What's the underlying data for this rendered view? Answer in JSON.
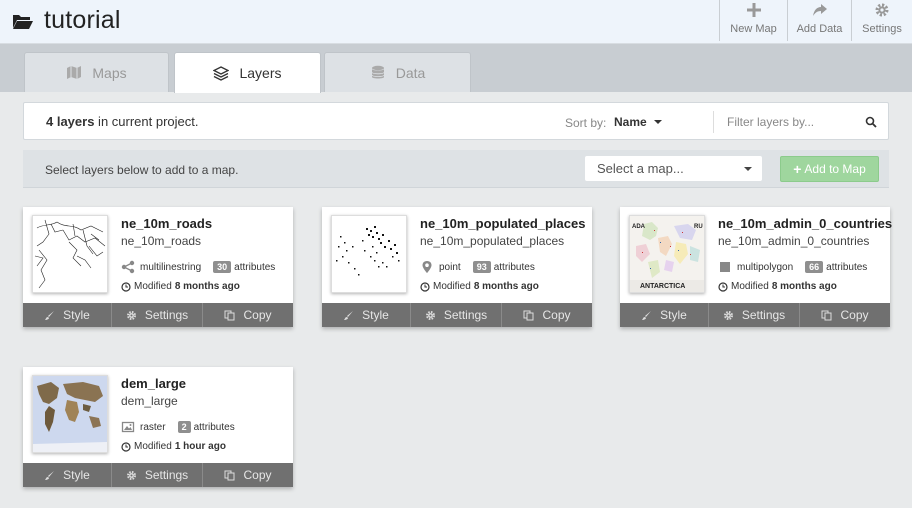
{
  "project": {
    "name": "tutorial"
  },
  "top_actions": [
    {
      "label": "New Map",
      "icon": "plus-icon"
    },
    {
      "label": "Add Data",
      "icon": "share-icon"
    },
    {
      "label": "Settings",
      "icon": "gear-icon"
    }
  ],
  "tabs": [
    {
      "label": "Maps",
      "icon": "map-icon",
      "active": false
    },
    {
      "label": "Layers",
      "icon": "layers-icon",
      "active": true
    },
    {
      "label": "Data",
      "icon": "database-icon",
      "active": false
    }
  ],
  "summary": {
    "count_text": "4 layers",
    "rest_text": " in current project.",
    "sort_label": "Sort by:",
    "sort_value": "Name",
    "filter_placeholder": "Filter layers by..."
  },
  "select_row": {
    "instruction": "Select layers below to add to a map.",
    "map_select_placeholder": "Select a map...",
    "add_button": "Add to Map",
    "add_button_color": "#9fd69e"
  },
  "layers": [
    {
      "title": "ne_10m_roads",
      "name": "ne_10m_roads",
      "geometry": "multilinestring",
      "geometry_icon": "share-nodes-icon",
      "attr_count": "30",
      "attr_label": "attributes",
      "modified_label": "Modified",
      "modified_value": "8 months ago"
    },
    {
      "title": "ne_10m_populated_places",
      "name": "ne_10m_populated_places",
      "geometry": "point",
      "geometry_icon": "map-marker-icon",
      "attr_count": "93",
      "attr_label": "attributes",
      "modified_label": "Modified",
      "modified_value": "8 months ago"
    },
    {
      "title": "ne_10m_admin_0_countries",
      "name": "ne_10m_admin_0_countries",
      "geometry": "multipolygon",
      "geometry_icon": "square-icon",
      "attr_count": "66",
      "attr_label": "attributes",
      "modified_label": "Modified",
      "modified_value": "8 months ago",
      "thumb_labels": {
        "top_left": "ADA",
        "top_right": "RU",
        "bottom": "ANTARCTICA"
      }
    },
    {
      "title": "dem_large",
      "name": "dem_large",
      "geometry": "raster",
      "geometry_icon": "image-icon",
      "attr_count": "2",
      "attr_label": "attributes",
      "modified_label": "Modified",
      "modified_value": "1 hour ago"
    }
  ],
  "card_actions": {
    "style": "Style",
    "settings": "Settings",
    "copy": "Copy"
  },
  "colors": {
    "topbar_bg": "#eef4fb",
    "card_bar": "#707070",
    "badge": "#8f8f8f"
  }
}
